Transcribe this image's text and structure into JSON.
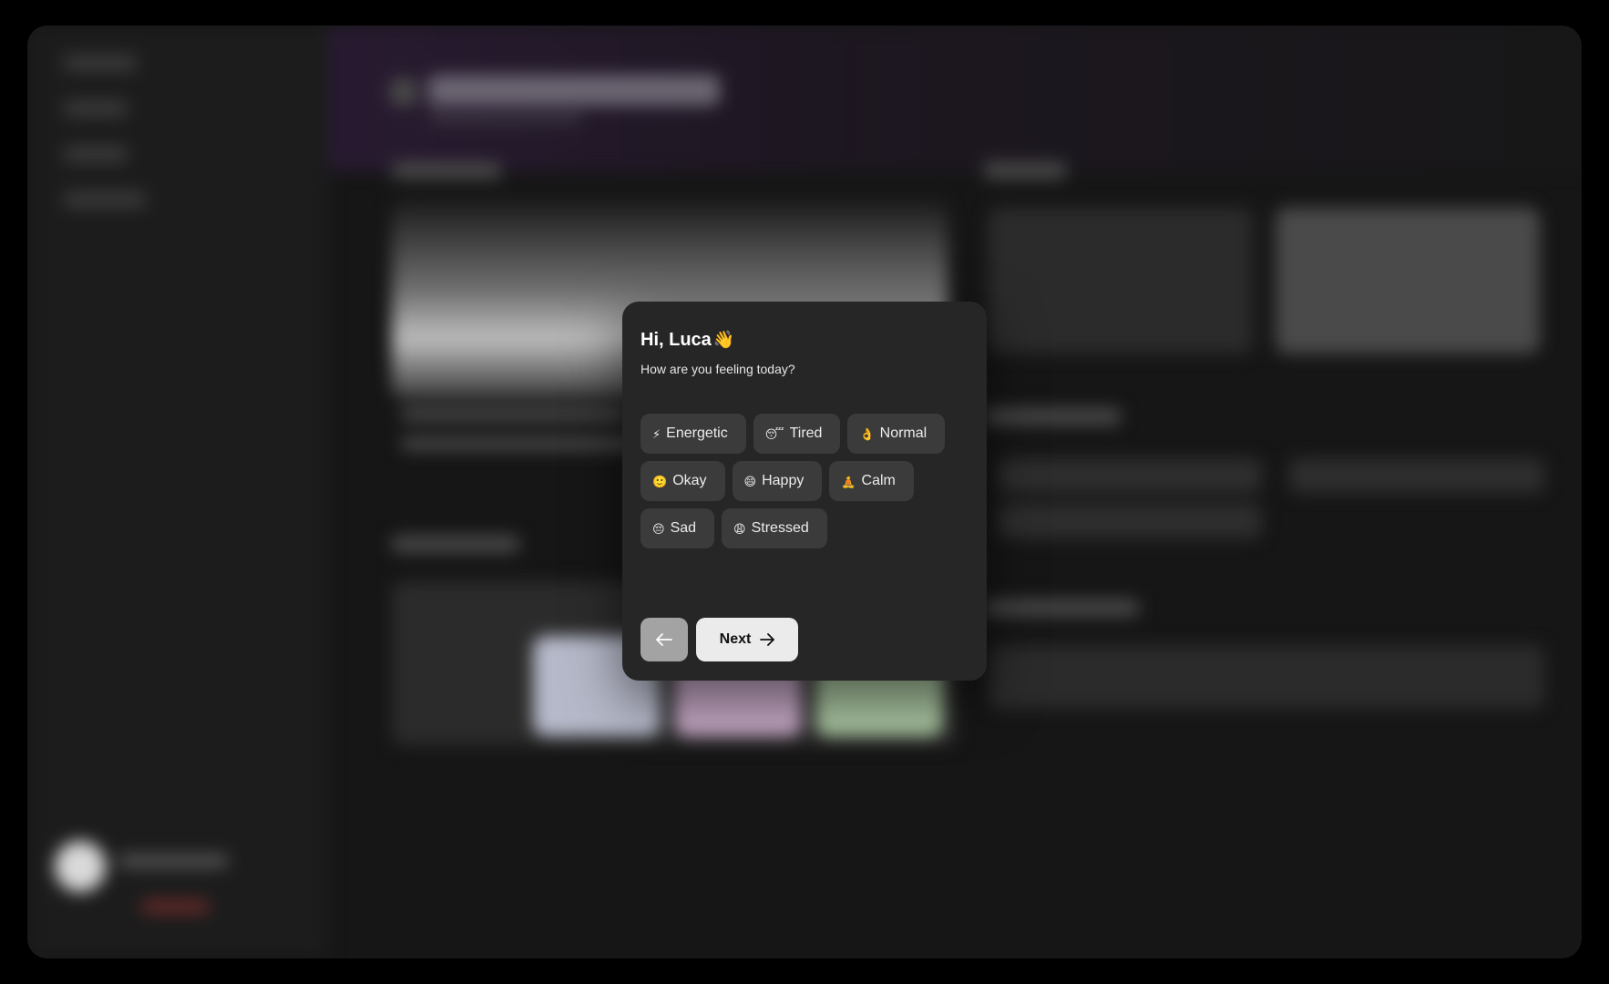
{
  "modal": {
    "greeting": "Hi, Luca",
    "greeting_emoji": "👋",
    "question": "How are you feeling today?",
    "moods": [
      {
        "emoji": "⚡",
        "label": "Energetic"
      },
      {
        "emoji": "😴",
        "label": "Tired"
      },
      {
        "emoji": "👌",
        "label": "Normal"
      },
      {
        "emoji": "🙂",
        "label": "Okay"
      },
      {
        "emoji": "😄",
        "label": "Happy"
      },
      {
        "emoji": "🧘",
        "label": "Calm"
      },
      {
        "emoji": "😔",
        "label": "Sad"
      },
      {
        "emoji": "😩",
        "label": "Stressed"
      }
    ],
    "back_icon": "arrow-left-icon",
    "next_label": "Next",
    "next_icon": "arrow-right-icon"
  },
  "colors": {
    "modal_bg": "#262626",
    "chip_bg": "#3b3b3b",
    "next_button_bg": "#ebebeb",
    "back_button_bg": "#a3a3a3"
  }
}
